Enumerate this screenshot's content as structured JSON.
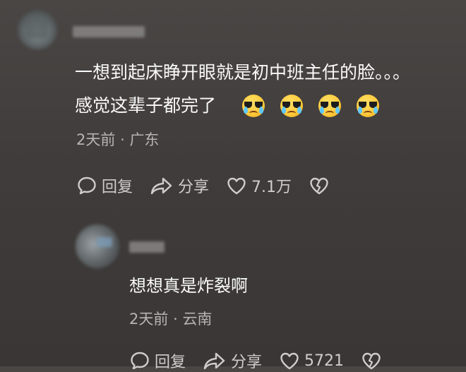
{
  "comment": {
    "line1": "一想到起床睁开眼就是初中班主任的脸。。。",
    "line2": "感觉这辈子都完了",
    "emojis": [
      "crying-cool-emoji",
      "crying-cool-emoji",
      "crying-cool-emoji",
      "crying-cool-emoji"
    ],
    "time": "2天前",
    "location": "广东",
    "separator": "·",
    "reply_label": "回复",
    "share_label": "分享",
    "likes": "7.1万"
  },
  "reply": {
    "text": "想想真是炸裂啊",
    "time": "2天前",
    "location": "云南",
    "separator": "·",
    "reply_label": "回复",
    "share_label": "分享",
    "likes": "5721"
  }
}
